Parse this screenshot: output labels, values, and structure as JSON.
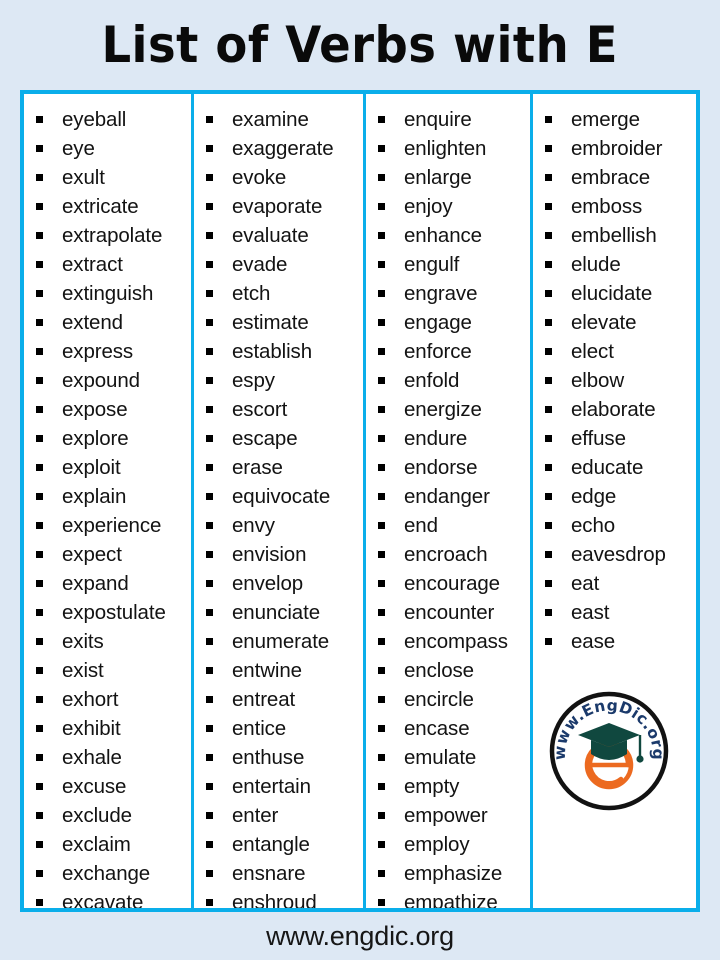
{
  "header": {
    "title": "List of Verbs with E"
  },
  "colors": {
    "background": "#dde8f4",
    "border_accent": "#0aaeea",
    "panel": "#ffffff",
    "text": "#131313",
    "logo_navy": "#1b3a6b",
    "logo_green": "#10483f",
    "logo_orange": "#ec6a20"
  },
  "table": {
    "columns": [
      {
        "name": "column-1",
        "words": [
          "eyeball",
          "eye",
          "exult",
          "extricate",
          "extrapolate",
          "extract",
          "extinguish",
          "extend",
          "express",
          "expound",
          "expose",
          "explore",
          "exploit",
          "explain",
          "experience",
          "expect",
          "expand",
          "expostulate",
          "exits",
          "exist",
          "exhort",
          "exhibit",
          "exhale",
          "excuse",
          "exclude",
          "exclaim",
          "exchange",
          "excavate"
        ]
      },
      {
        "name": "column-2",
        "words": [
          "examine",
          "exaggerate",
          "evoke",
          "evaporate",
          "evaluate",
          "evade",
          "etch",
          "estimate",
          "establish",
          "espy",
          "escort",
          "escape",
          "erase",
          "equivocate",
          "envy",
          "envision",
          "envelop",
          "enunciate",
          "enumerate",
          "entwine",
          "entreat",
          "entice",
          "enthuse",
          "entertain",
          "enter",
          "entangle",
          "ensnare",
          "enshroud"
        ]
      },
      {
        "name": "column-3",
        "words": [
          "enquire",
          "enlighten",
          "enlarge",
          "enjoy",
          "enhance",
          "engulf",
          "engrave",
          "engage",
          "enforce",
          "enfold",
          "energize",
          "endure",
          "endorse",
          "endanger",
          "end",
          "encroach",
          "encourage",
          "encounter",
          "encompass",
          "enclose",
          "encircle",
          "encase",
          "emulate",
          "empty",
          "empower",
          "employ",
          "emphasize",
          "empathize"
        ]
      },
      {
        "name": "column-4",
        "words": [
          "emerge",
          "embroider",
          "embrace",
          "emboss",
          "embellish",
          "elude",
          "elucidate",
          "elevate",
          "elect",
          "elbow",
          "elaborate",
          "effuse",
          "educate",
          "edge",
          "echo",
          "eavesdrop",
          "eat",
          "east",
          "ease"
        ]
      }
    ]
  },
  "logo": {
    "name": "engdic-logo",
    "text": "www.EngDic.org",
    "monogram": "e"
  },
  "footer": {
    "url": "www.engdic.org"
  }
}
